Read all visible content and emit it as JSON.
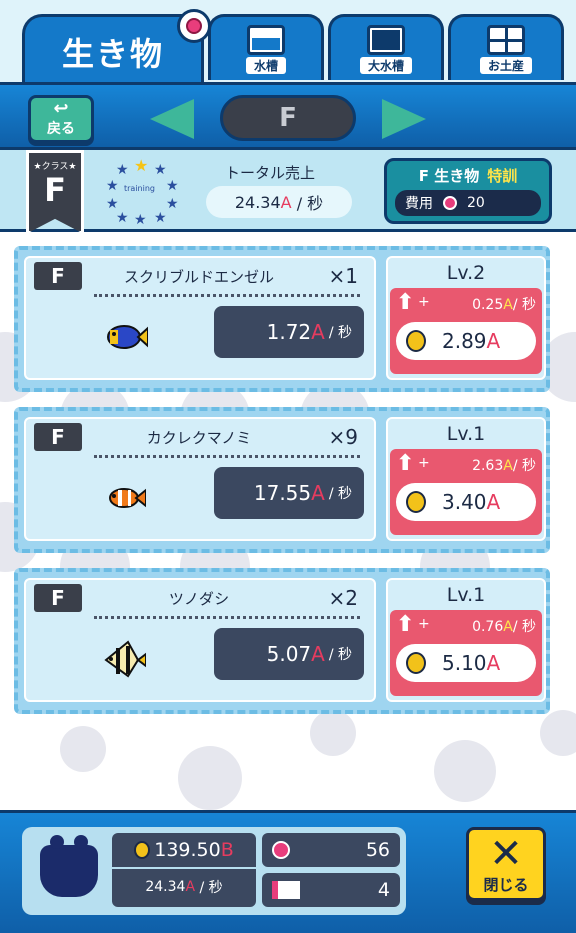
{
  "tabs": {
    "active": "生き物",
    "items": [
      {
        "label": "水槽",
        "icon": "tank-icon"
      },
      {
        "label": "大水槽",
        "icon": "big-tank-icon"
      },
      {
        "label": "お土産",
        "icon": "gift-icon"
      }
    ]
  },
  "nav": {
    "back_label": "戻る",
    "back_arrow": "↩",
    "class_value": "F"
  },
  "info": {
    "class_tag": "★クラス★",
    "class_value": "F",
    "training_word": "training",
    "total_label": "トータル売上",
    "total_value": "24.34",
    "total_unit_letter": "A",
    "total_unit": "/ 秒",
    "training_title": "F 生き物",
    "training_special": "特訓",
    "training_cost_label": "費用",
    "training_cost_value": "20"
  },
  "creatures": [
    {
      "class": "F",
      "name": "スクリブルドエンゼル",
      "count": "×1",
      "rate": "1.72",
      "rate_letter": "A",
      "rate_unit": "/ 秒",
      "level": "Lv.2",
      "upgrade_plus": "+",
      "upgrade_rate": "0.25",
      "upgrade_letter": "A",
      "upgrade_unit": "/ 秒",
      "cost": "2.89",
      "cost_letter": "A"
    },
    {
      "class": "F",
      "name": "カクレクマノミ",
      "count": "×9",
      "rate": "17.55",
      "rate_letter": "A",
      "rate_unit": "/ 秒",
      "level": "Lv.1",
      "upgrade_plus": "+",
      "upgrade_rate": "2.63",
      "upgrade_letter": "A",
      "upgrade_unit": "/ 秒",
      "cost": "3.40",
      "cost_letter": "A"
    },
    {
      "class": "F",
      "name": "ツノダシ",
      "count": "×2",
      "rate": "5.07",
      "rate_letter": "A",
      "rate_unit": "/ 秒",
      "level": "Lv.1",
      "upgrade_plus": "+",
      "upgrade_rate": "0.76",
      "upgrade_letter": "A",
      "upgrade_unit": "/ 秒",
      "cost": "5.10",
      "cost_letter": "A"
    }
  ],
  "footer": {
    "money": "139.50",
    "money_letter": "B",
    "income": "24.34",
    "income_letter": "A",
    "income_unit": "/ 秒",
    "gems": "56",
    "tickets": "4",
    "close_mark": "✕",
    "close_label": "閉じる"
  },
  "colors": {
    "accent_blue": "#1479c9",
    "currency_red": "#e63c5f",
    "upgrade_red": "#e9586f",
    "close_yellow": "#ffd31f"
  }
}
